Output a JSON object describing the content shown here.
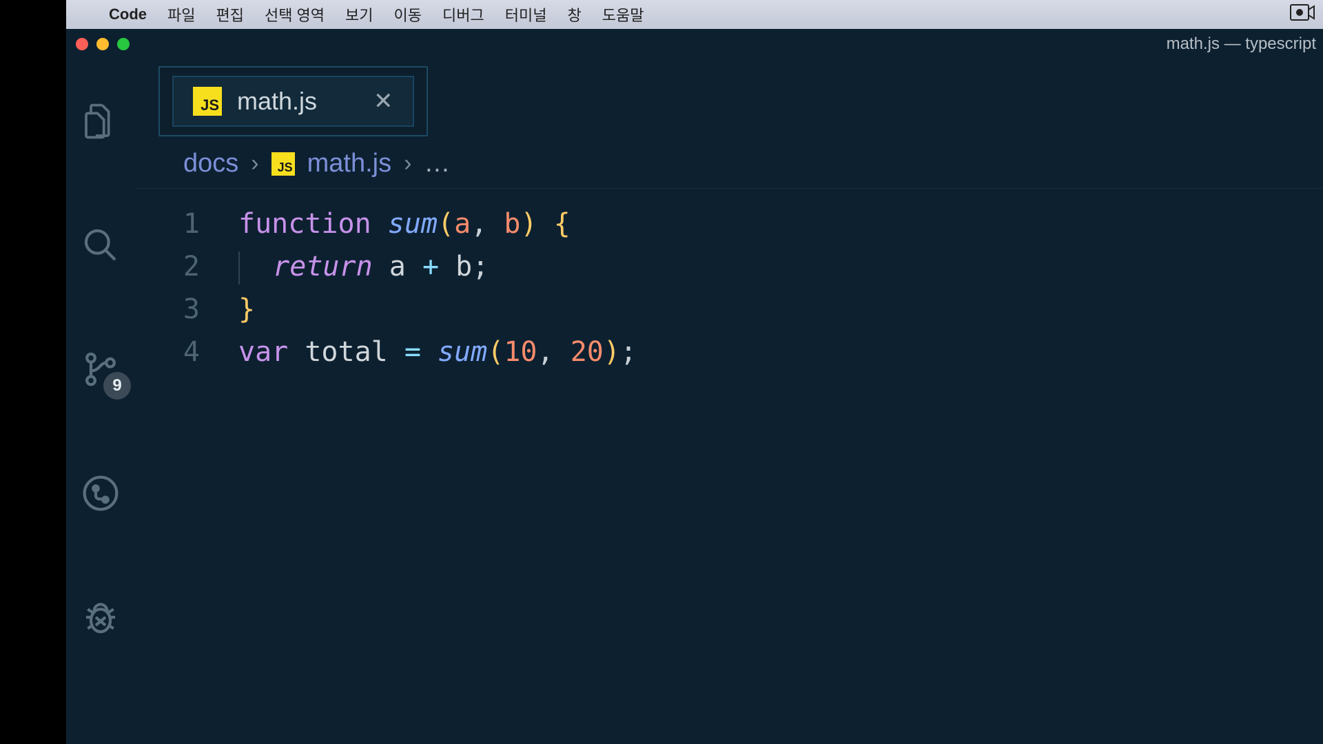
{
  "menubar": {
    "appname": "Code",
    "items": [
      "파일",
      "편집",
      "선택 영역",
      "보기",
      "이동",
      "디버그",
      "터미널",
      "창",
      "도움말"
    ]
  },
  "window": {
    "title": "math.js — typescript"
  },
  "activitybar": {
    "scm_badge": "9"
  },
  "tab": {
    "filetype_label": "JS",
    "filename": "math.js"
  },
  "breadcrumb": {
    "segments": [
      "docs",
      "math.js"
    ],
    "filetype_label": "JS",
    "last": "…"
  },
  "code": {
    "line_numbers": [
      "1",
      "2",
      "3",
      "4"
    ],
    "line1": {
      "kw": "function",
      "fn": "sum",
      "open": "(",
      "p1": "a",
      "comma": ", ",
      "p2": "b",
      "close": ")",
      "brace": " {"
    },
    "line2": {
      "kw": "return",
      "expr_a": "a",
      "op": " + ",
      "expr_b": "b",
      "semi": ";"
    },
    "line3": {
      "brace": "}"
    },
    "line4": {
      "kw": "var",
      "id": " total ",
      "eq": "= ",
      "fn": "sum",
      "open": "(",
      "n1": "10",
      "comma": ", ",
      "n2": "20",
      "close": ")",
      "semi": ";"
    }
  }
}
